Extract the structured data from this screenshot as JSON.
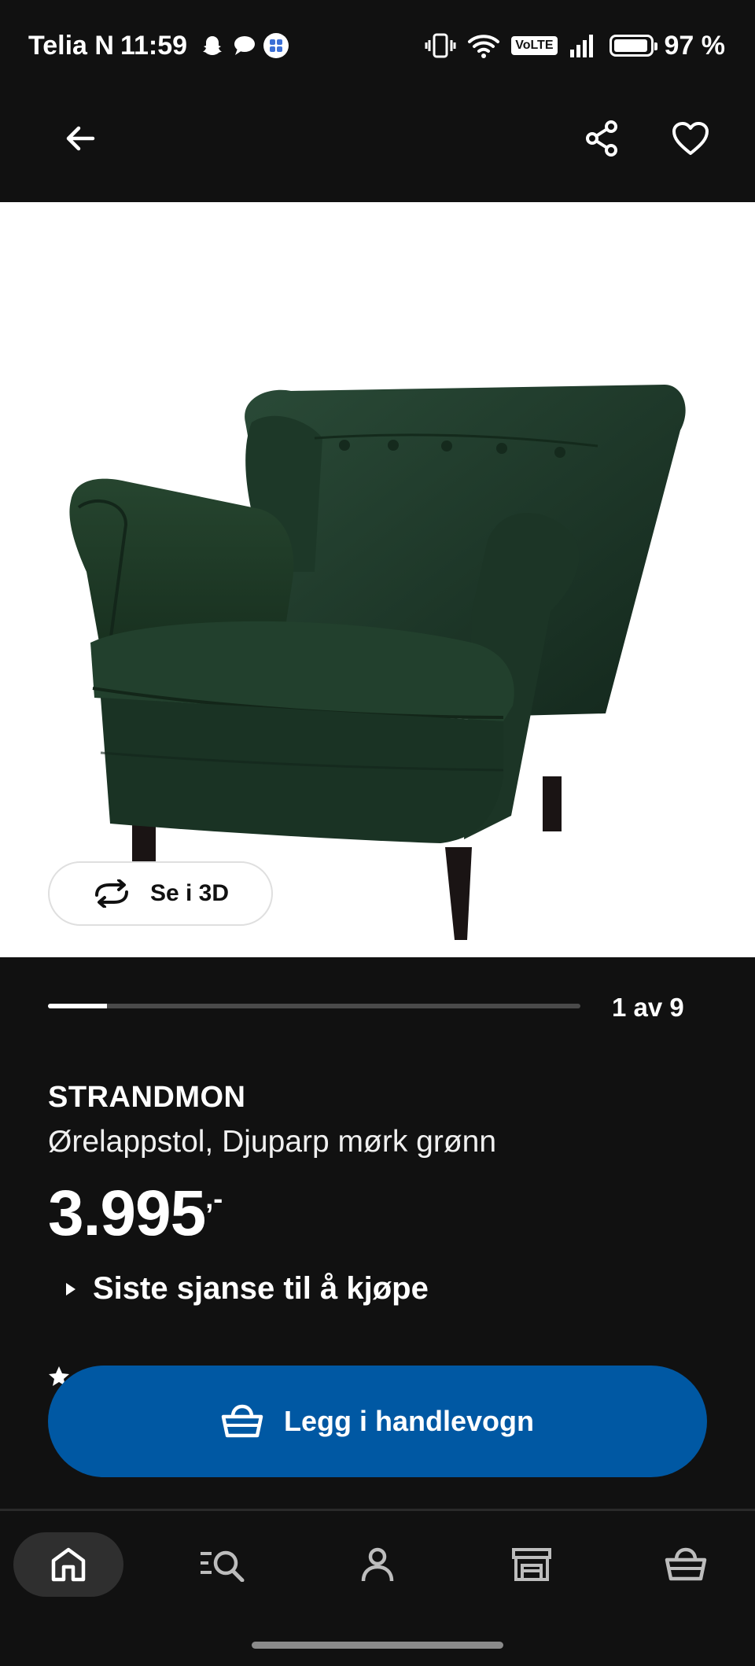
{
  "status_bar": {
    "carrier": "Telia N",
    "time": "11:59",
    "battery": "97 %",
    "battery_level": 0.97,
    "network_badge": "VoLTE",
    "notification_icons": [
      "snapchat-icon",
      "chat-bubble-icon",
      "app-grid-icon"
    ],
    "system_icons": [
      "vibrate-icon",
      "wifi-icon",
      "volte-icon",
      "signal-icon",
      "battery-icon"
    ]
  },
  "top_bar": {
    "icons": [
      "back-arrow-icon",
      "share-icon",
      "heart-icon"
    ]
  },
  "gallery": {
    "view_3d_label": "Se i 3D",
    "page_indicator": "1 av 9",
    "current_image": 1,
    "total_images": 9
  },
  "product": {
    "name": "STRANDMON",
    "description": "Ørelappstol, Djuparp mørk grønn",
    "price_main": "3.995",
    "price_suffix": ",-",
    "notice": "Siste sjanse til å kjøpe"
  },
  "cta": {
    "add_to_cart_label": "Legg i handlevogn"
  },
  "bottom_nav": {
    "items": [
      {
        "name": "home",
        "icon": "home-icon",
        "active": true
      },
      {
        "name": "search",
        "icon": "search-list-icon",
        "active": false
      },
      {
        "name": "profile",
        "icon": "person-icon",
        "active": false
      },
      {
        "name": "stores",
        "icon": "store-icon",
        "active": false
      },
      {
        "name": "cart",
        "icon": "basket-icon",
        "active": false
      }
    ]
  },
  "colors": {
    "background": "#111111",
    "accent_blue": "#0058a3",
    "chair_green": "#1f3a2b"
  }
}
